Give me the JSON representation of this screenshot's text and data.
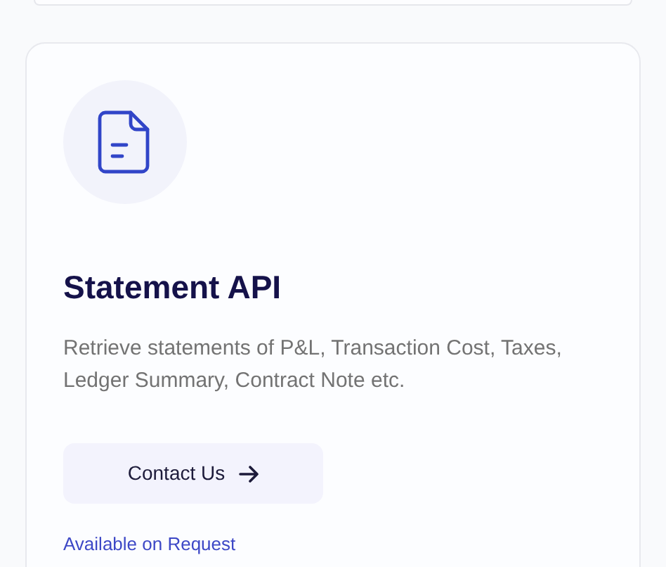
{
  "card": {
    "title": "Statement API",
    "description": "Retrieve statements of P&L, Transaction Cost, Taxes, Ledger Summary, Contract Note etc.",
    "button": "Contact Us",
    "note": "Available on Request"
  }
}
